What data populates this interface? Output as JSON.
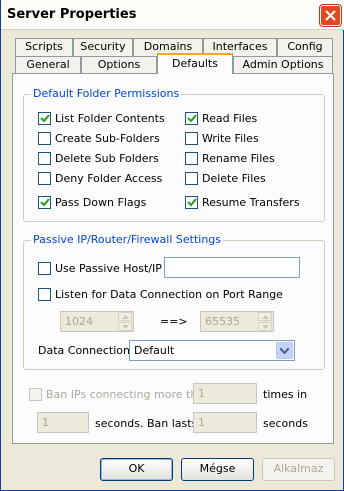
{
  "window": {
    "title": "Server Properties"
  },
  "tabs": {
    "row1": [
      "Scripts",
      "Security",
      "Domains",
      "Interfaces",
      "Config"
    ],
    "row2": [
      "General",
      "Options",
      "Defaults",
      "Admin Options"
    ],
    "active": "Defaults"
  },
  "folder_permissions": {
    "legend": "Default Folder Permissions",
    "list_folder_contents": {
      "label": "List Folder Contents",
      "checked": true
    },
    "create_sub_folders": {
      "label": "Create Sub-Folders",
      "checked": false
    },
    "delete_sub_folders": {
      "label": "Delete Sub Folders",
      "checked": false
    },
    "deny_folder_access": {
      "label": "Deny Folder Access",
      "checked": false
    },
    "pass_down_flags": {
      "label": "Pass Down Flags",
      "checked": true
    },
    "read_files": {
      "label": "Read Files",
      "checked": true
    },
    "write_files": {
      "label": "Write Files",
      "checked": false
    },
    "rename_files": {
      "label": "Rename Files",
      "checked": false
    },
    "delete_files": {
      "label": "Delete Files",
      "checked": false
    },
    "resume_transfers": {
      "label": "Resume Transfers",
      "checked": true
    }
  },
  "passive": {
    "legend": "Passive IP/Router/Firewall Settings",
    "use_passive_label": "Use Passive Host/IP",
    "passive_host_value": "",
    "listen_port_range_label": "Listen for Data Connection on Port Range",
    "port_from": "1024",
    "arrow": "==>",
    "port_to": "65535",
    "data_connection_label": "Data Connection",
    "data_connection_value": "Default"
  },
  "ban": {
    "ban_label": "Ban IPs connecting more than",
    "times_value": "1",
    "times_in_label": "times in",
    "seconds_value": "1",
    "seconds_label": "seconds.",
    "ban_lasts_label": "Ban lasts",
    "ban_lasts_value": "1",
    "seconds2_label": "seconds"
  },
  "buttons": {
    "ok": "OK",
    "cancel": "Mégse",
    "apply": "Alkalmaz"
  }
}
